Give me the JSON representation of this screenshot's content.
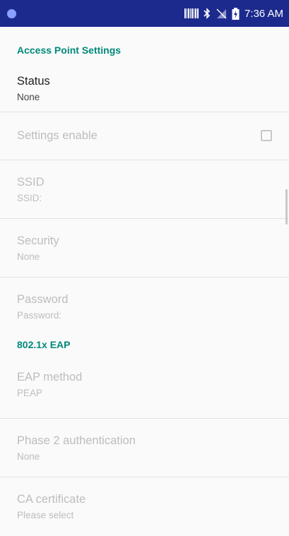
{
  "status_bar": {
    "time": "7:36 AM",
    "icons": [
      "circle-notification-icon",
      "barcode-icon",
      "bluetooth-icon",
      "signal-off-icon",
      "battery-charging-icon"
    ]
  },
  "sections": {
    "access_point": "Access Point Settings",
    "eap": "802.1x EAP"
  },
  "prefs": {
    "status": {
      "title": "Status",
      "summary": "None"
    },
    "settings_enable": {
      "title": "Settings enable",
      "checked": false
    },
    "ssid": {
      "title": "SSID",
      "summary": "SSID:"
    },
    "security": {
      "title": "Security",
      "summary": "None"
    },
    "password": {
      "title": "Password",
      "summary": "Password:"
    },
    "eap_method": {
      "title": "EAP method",
      "summary": "PEAP"
    },
    "phase2": {
      "title": "Phase 2 authentication",
      "summary": "None"
    },
    "ca_cert": {
      "title": "CA certificate",
      "summary": "Please select"
    }
  }
}
